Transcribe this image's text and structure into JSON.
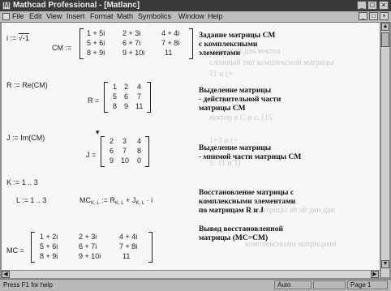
{
  "window": {
    "title": "Mathcad Professional - [Matlanc]",
    "minimize_glyph": "_",
    "maximize_glyph": "□",
    "close_glyph": "×"
  },
  "menubar": {
    "items": [
      "File",
      "Edit",
      "View",
      "Insert",
      "Format",
      "Math",
      "Symbolics",
      "Window",
      "Help"
    ],
    "minimize_glyph": "_",
    "restore_glyph": "□",
    "close_glyph": "×"
  },
  "document": {
    "background_text": [
      "ничeский для вектоа",
      "сложный тип комплексной матрицы",
      "11 и (+",
      "вектор в С и с. (15",
      "1+3 и (+",
      "5:  11 и 1)",
      "1.2 матрицы ab ab дан дан",
      "комплексными матрицами"
    ],
    "blocks": {
      "i_def": {
        "lhs": "i :=",
        "rhs": "√-1"
      },
      "cm_def": {
        "lhs": "CM :=",
        "rows": [
          [
            "1 + 5i",
            "2 + 3i",
            "4 + 4i"
          ],
          [
            "5 + 6i",
            "6 + 7i",
            "7 + 8i"
          ],
          [
            "8 + 9i",
            "9 + 10i",
            "11"
          ]
        ],
        "note": [
          "Задание матрицы CM",
          "с комплексными",
          "элементами"
        ]
      },
      "r_def": {
        "expr": "R := Re(CM)",
        "lhs": "R =",
        "rows": [
          [
            "1",
            "2",
            "4"
          ],
          [
            "5",
            "6",
            "7"
          ],
          [
            "8",
            "9",
            "11"
          ]
        ],
        "note": [
          "Выделение матрицы",
          "- действительной части",
          "матрицы CM"
        ]
      },
      "j_def": {
        "expr": "J := Im(CM)",
        "lhs": "J =",
        "rows": [
          [
            "2",
            "3",
            "4"
          ],
          [
            "6",
            "7",
            "8"
          ],
          [
            "9",
            "10",
            "0"
          ]
        ],
        "note": [
          "Выделение матрицы",
          "- мнимой части матрицы CM"
        ]
      },
      "k_def": {
        "expr": "K := 1 .. 3"
      },
      "l_def": {
        "expr": "L := 1 .. 3",
        "mc_expr_lhs": "MC",
        "mc_sub": "K, L",
        "mc_expr_rhs_a": ":= R",
        "r_sub": "K, L",
        "mc_expr_rhs_b": "+ J",
        "j_sub": "K, L",
        "mc_expr_tail": "· i",
        "note": [
          "Восстановление матрицы с",
          "комплексными элементами",
          "по матрицам R и J"
        ]
      },
      "mc_result": {
        "lhs": "MC =",
        "rows": [
          [
            "1 + 2i",
            "2 + 3i",
            "4 + 4i"
          ],
          [
            "5 + 6i",
            "6 + 7i",
            "7 + 8i"
          ],
          [
            "8 + 9i",
            "9 + 10i",
            "11"
          ]
        ],
        "note": [
          "Вывод восстановленной",
          "матрицы (MC=CM)"
        ]
      }
    }
  },
  "statusbar": {
    "help": "Press F1 for help",
    "mode": "Auto",
    "page": "Page 1"
  }
}
